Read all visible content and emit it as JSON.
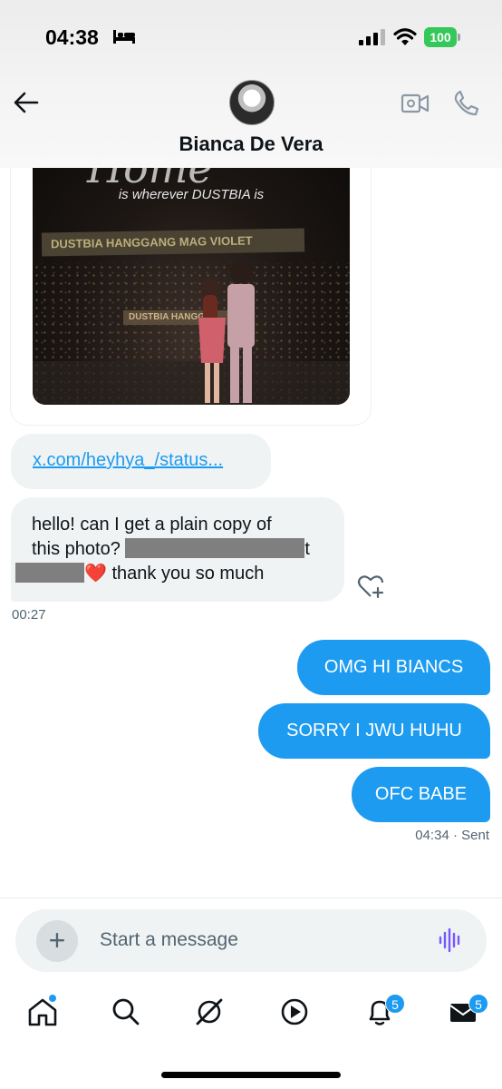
{
  "status_bar": {
    "time": "04:38",
    "battery": "100"
  },
  "header": {
    "contact_name": "Bianca De Vera"
  },
  "conversation": {
    "shared_post": {
      "script_title": "Home",
      "caption": "is wherever DUSTBIA is",
      "banner": "DUSTBIA HANGGANG MAG VIOLET",
      "banner2": "DUSTBIA HANGG"
    },
    "link": "x.com/heyhya_/status...",
    "incoming": {
      "line1": "hello! can I get a plain copy of",
      "line2_start": "this photo?",
      "line2_end": "t",
      "line3_end": "thank you so much",
      "heart": "❤️",
      "time": "00:27"
    },
    "outgoing": [
      {
        "text": "OMG HI BIANCS"
      },
      {
        "text": "SORRY I JWU HUHU"
      },
      {
        "text": "OFC BABE"
      }
    ],
    "outgoing_time": "04:34",
    "outgoing_status": "· Sent"
  },
  "composer": {
    "placeholder": "Start a message",
    "plus": "+"
  },
  "nav": {
    "notifications_badge": "5",
    "messages_badge": "5"
  },
  "colors": {
    "accent": "#1d9bf0",
    "bubble_in": "#eff3f4",
    "battery": "#34c759"
  }
}
